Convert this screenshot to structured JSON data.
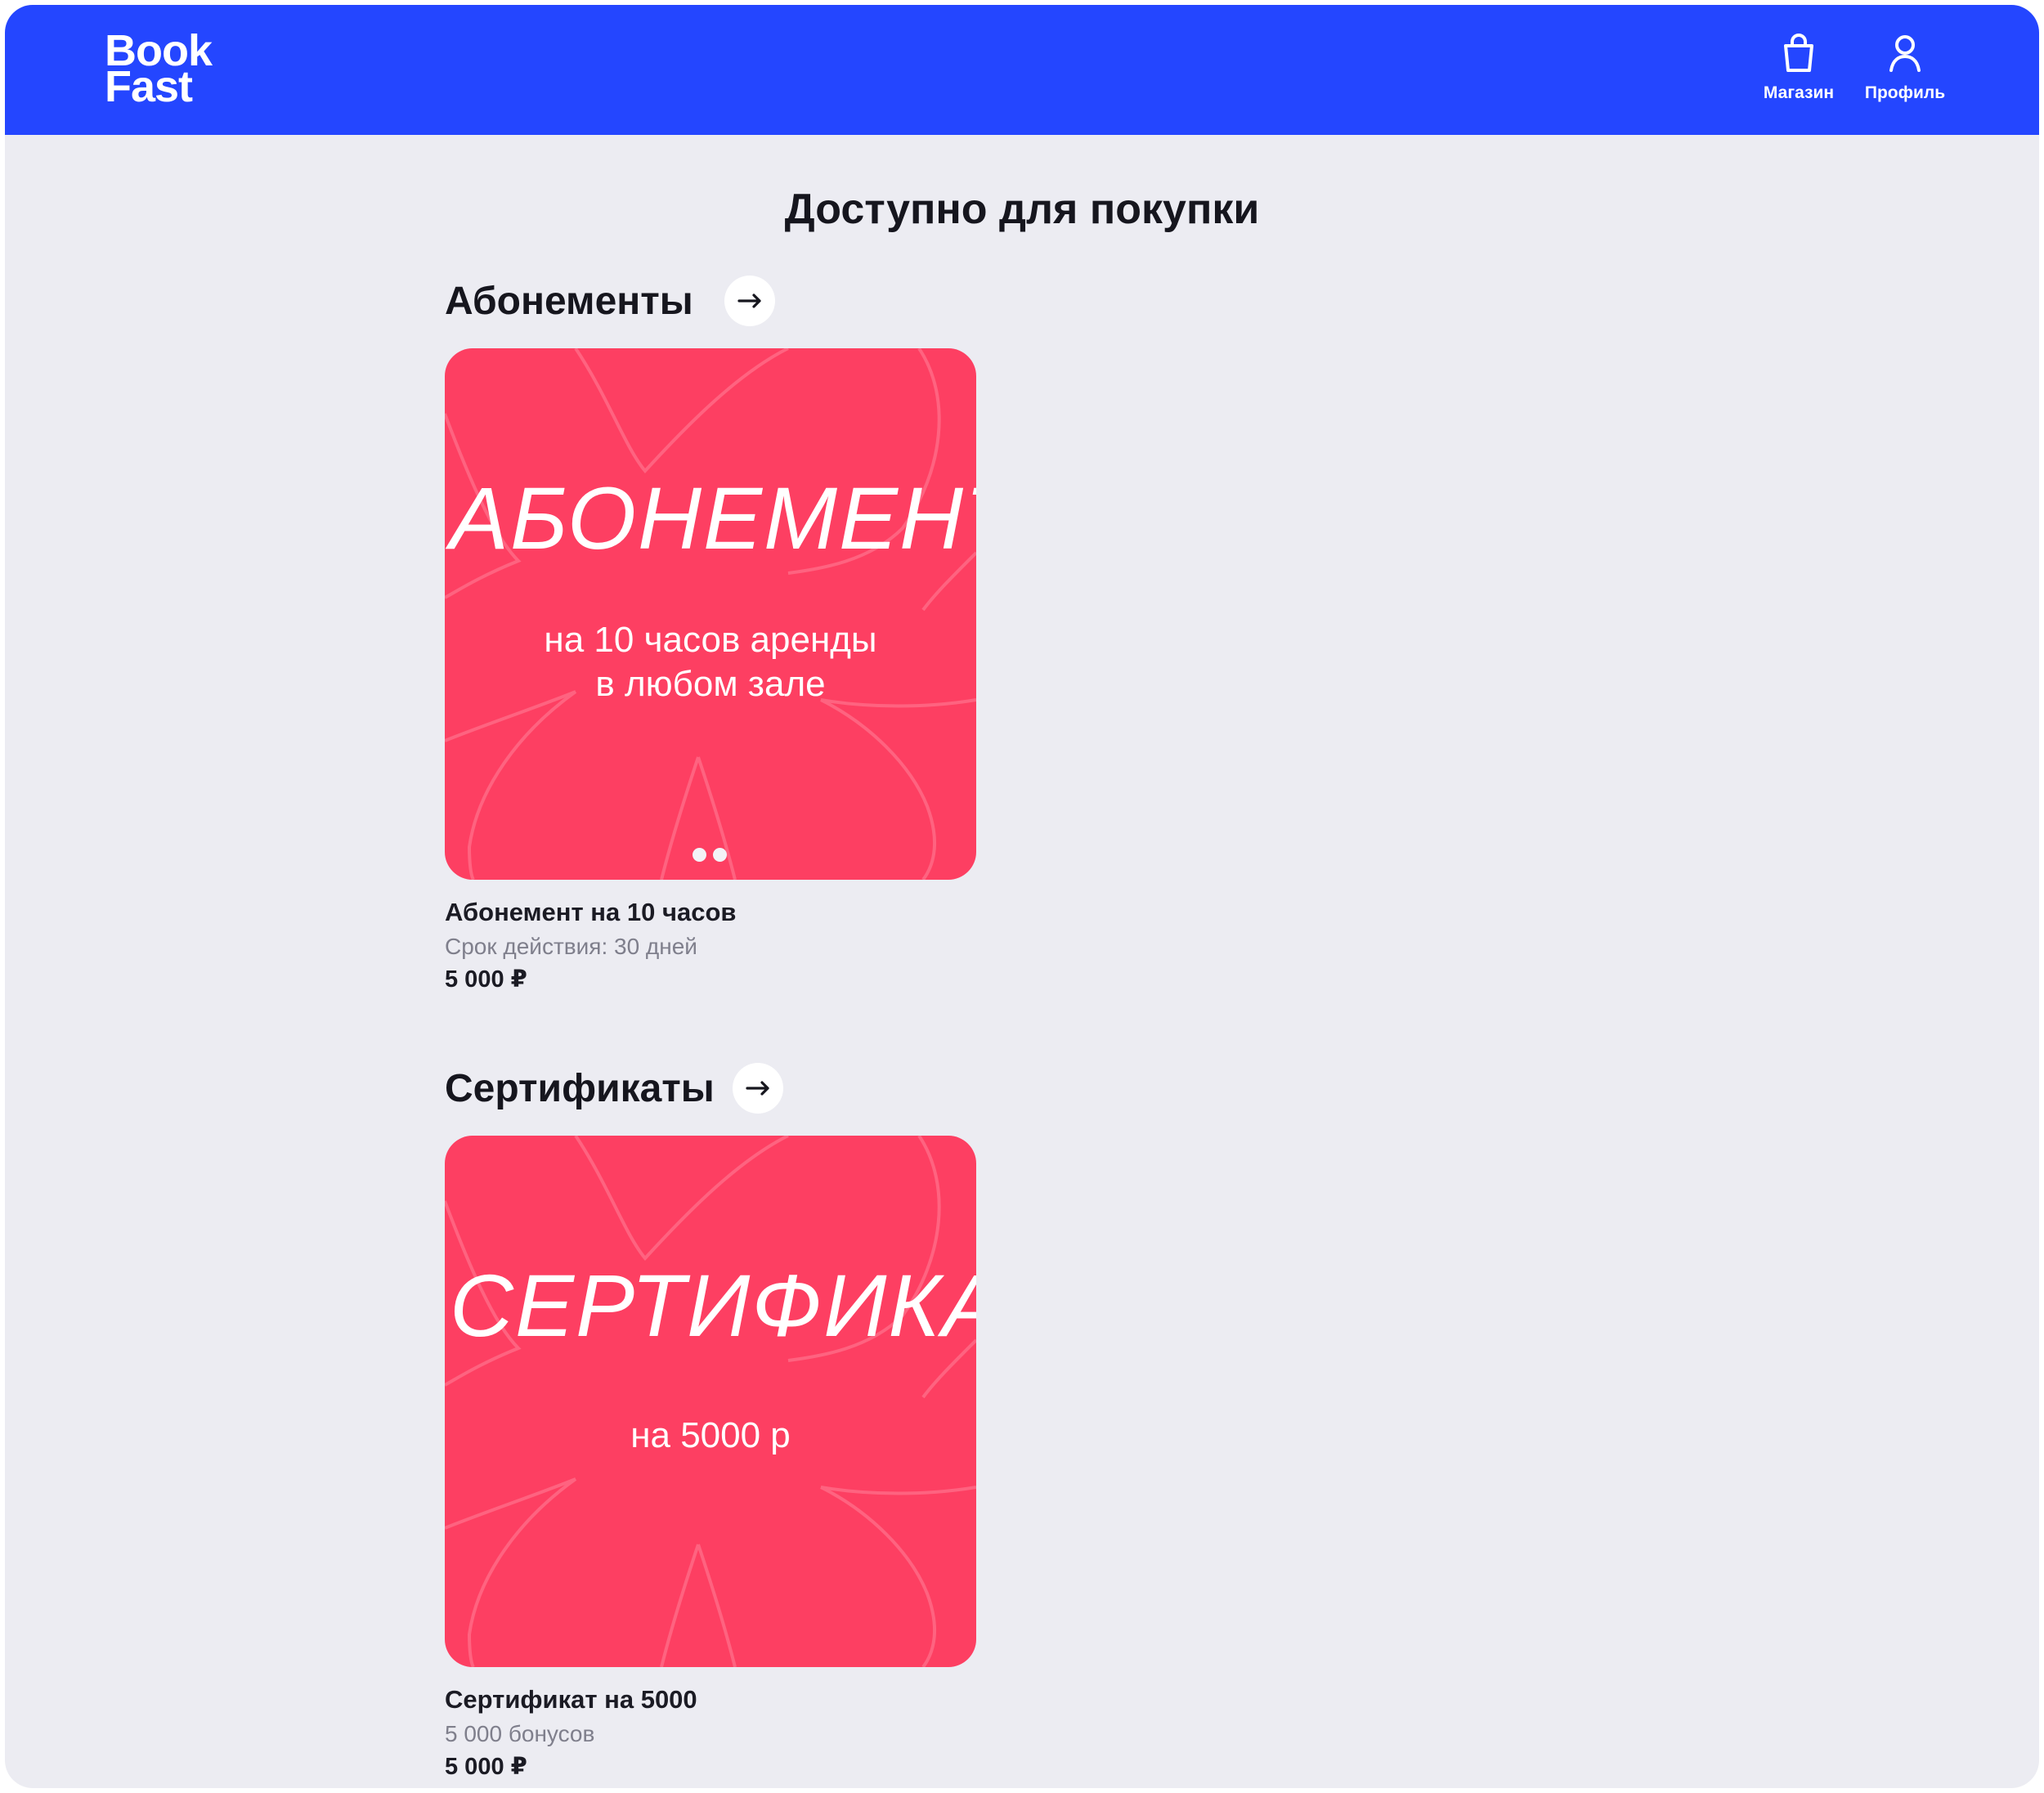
{
  "header": {
    "logo_line1": "Book",
    "logo_line2": "Fast",
    "nav": [
      {
        "label": "Магазин",
        "icon": "shopping-bag-icon"
      },
      {
        "label": "Профиль",
        "icon": "user-icon"
      }
    ],
    "brand_color": "#2446ff"
  },
  "page_title": "Доступно для покупки",
  "sections": [
    {
      "title": "Абонементы",
      "arrow_icon": "arrow-right-icon",
      "card": {
        "big_text": "АБОНЕМЕНТ",
        "sub_line1": "на 10 часов аренды",
        "sub_line2": "в любом зале",
        "color": "#fd3f62"
      },
      "product": {
        "name": "Абонемент на 10 часов",
        "meta": "Срок действия: 30 дней",
        "price": "5 000 ₽"
      }
    },
    {
      "title": "Сертификаты",
      "arrow_icon": "arrow-right-icon",
      "card": {
        "big_text": "СЕРТИФИКАТ",
        "sub_line1": "на 5000 р",
        "color": "#fd3f62"
      },
      "product": {
        "name": "Сертификат на 5000",
        "meta": "5 000 бонусов",
        "price": "5 000 ₽"
      }
    }
  ]
}
